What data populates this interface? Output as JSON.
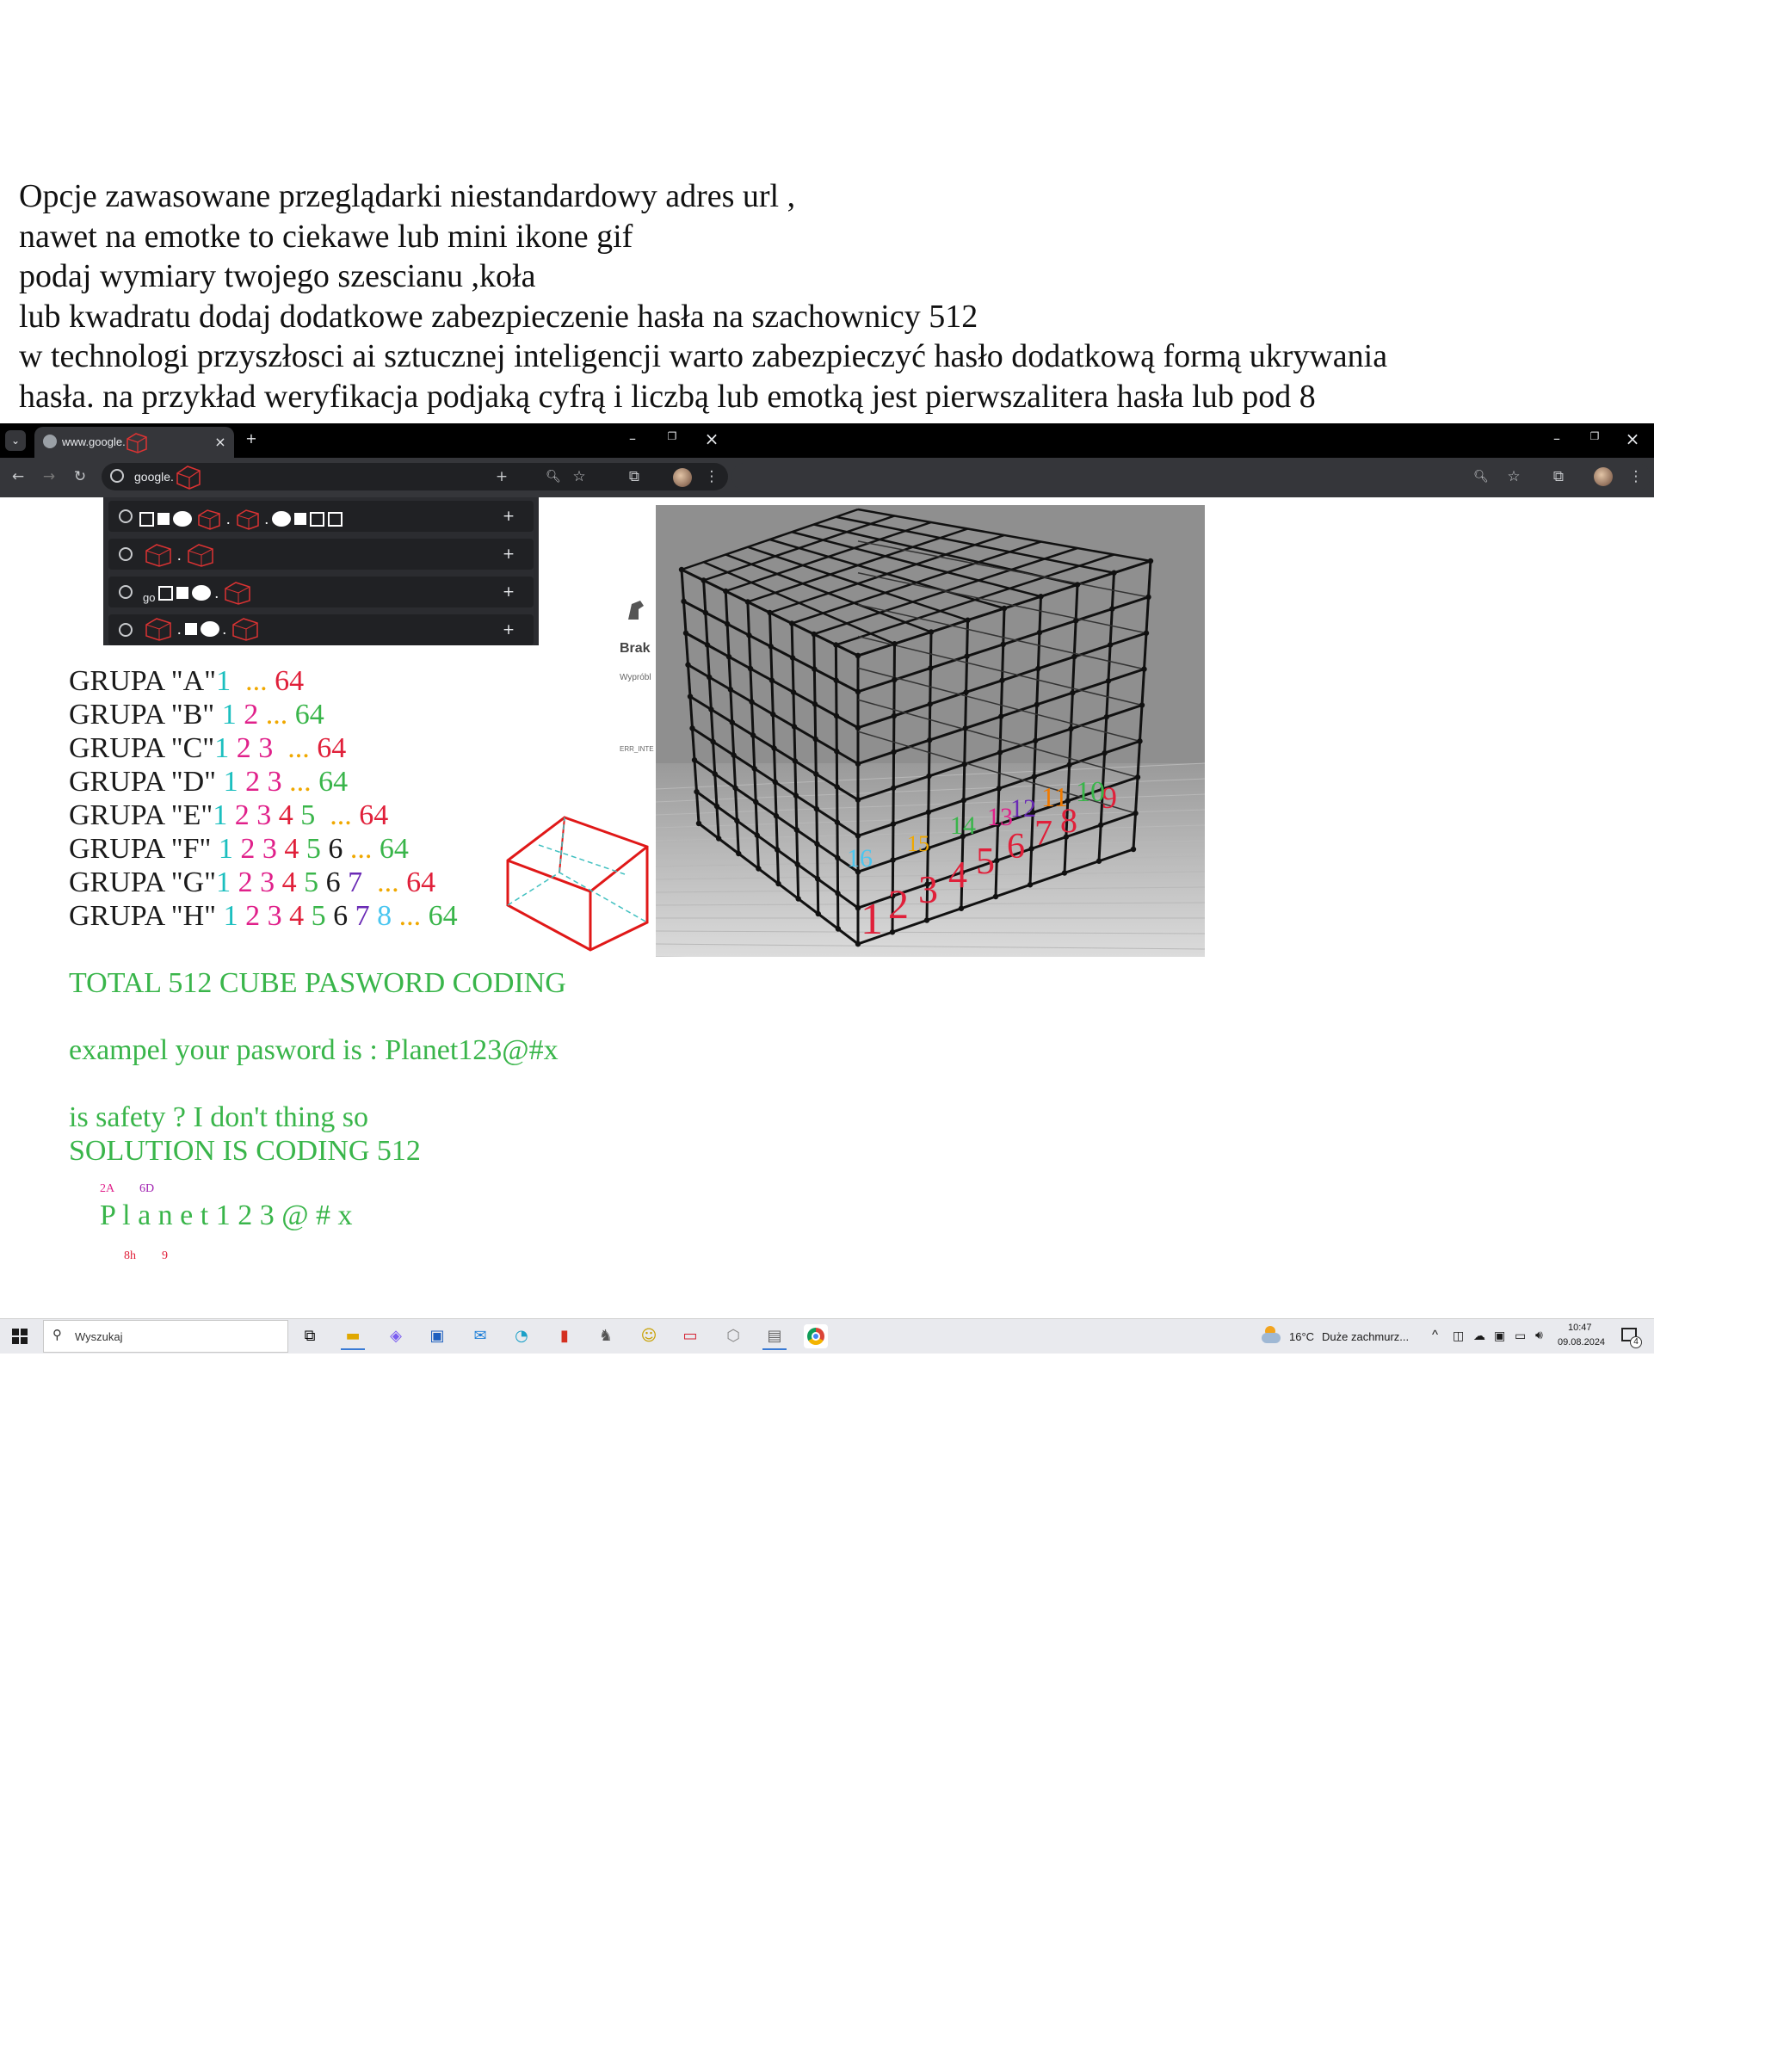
{
  "intro": [
    "Opcje zawasowane przeglądarki niestandardowy adres url ,",
    "nawet na emotke to ciekawe lub mini ikone gif",
    "podaj wymiary twojego szescianu ,koła",
    "lub kwadratu  dodaj dodatkowe zabezpieczenie hasła na szachownicy 512",
    "w technologi przyszłosci ai sztucznej inteligencji warto zabezpieczyć hasło dodatkową formą ukrywania",
    "hasła. na przykład weryfikacja podjaką cyfrą i liczbą lub emotką jest pierwszalitera hasła  lub pod 8"
  ],
  "browser": {
    "tab_title": "www.google.",
    "omnibox_text": "google.",
    "url_rows": [
      {
        "prefix": ""
      },
      {
        "prefix": ""
      },
      {
        "prefix": "go"
      },
      {
        "prefix": ""
      }
    ],
    "new_tab_symbol": "+",
    "close_symbol": "×",
    "minimize_symbol": "–",
    "restore_symbol": "❐"
  },
  "groups": [
    {
      "label": "GRUPA \"A\"",
      "tokens": [
        {
          "t": "1",
          "c": "teal"
        },
        {
          "t": "  ...",
          "c": "gold"
        },
        {
          "t": " 64",
          "c": "red"
        }
      ]
    },
    {
      "label": "GRUPA \"B\" ",
      "tokens": [
        {
          "t": "1",
          "c": "teal"
        },
        {
          "t": " 2",
          "c": "pink"
        },
        {
          "t": " ...",
          "c": "gold"
        },
        {
          "t": " 64",
          "c": "green"
        }
      ]
    },
    {
      "label": "GRUPA \"C\"",
      "tokens": [
        {
          "t": "1",
          "c": "teal"
        },
        {
          "t": " 2",
          "c": "pink"
        },
        {
          "t": " 3",
          "c": "pink"
        },
        {
          "t": "  ...",
          "c": "gold"
        },
        {
          "t": " 64",
          "c": "red"
        }
      ]
    },
    {
      "label": "GRUPA \"D\" ",
      "tokens": [
        {
          "t": "1",
          "c": "teal"
        },
        {
          "t": " 2",
          "c": "pink"
        },
        {
          "t": " 3",
          "c": "pink"
        },
        {
          "t": " ...",
          "c": "gold"
        },
        {
          "t": " 64",
          "c": "green"
        }
      ]
    },
    {
      "label": "GRUPA \"E\"",
      "tokens": [
        {
          "t": "1",
          "c": "teal"
        },
        {
          "t": " 2",
          "c": "pink"
        },
        {
          "t": " 3",
          "c": "pink"
        },
        {
          "t": " 4",
          "c": "red"
        },
        {
          "t": " 5",
          "c": "green"
        },
        {
          "t": "  ...",
          "c": "gold"
        },
        {
          "t": " 64",
          "c": "red"
        }
      ]
    },
    {
      "label": "GRUPA \"F\" ",
      "tokens": [
        {
          "t": "1",
          "c": "teal"
        },
        {
          "t": " 2",
          "c": "pink"
        },
        {
          "t": " 3",
          "c": "pink"
        },
        {
          "t": " 4",
          "c": "red"
        },
        {
          "t": " 5",
          "c": "green"
        },
        {
          "t": " 6",
          "c": "dark"
        },
        {
          "t": " ...",
          "c": "gold"
        },
        {
          "t": " 64",
          "c": "green"
        }
      ]
    },
    {
      "label": "GRUPA \"G\"",
      "tokens": [
        {
          "t": "1",
          "c": "teal"
        },
        {
          "t": " 2",
          "c": "pink"
        },
        {
          "t": " 3",
          "c": "pink"
        },
        {
          "t": " 4",
          "c": "red"
        },
        {
          "t": " 5",
          "c": "green"
        },
        {
          "t": " 6",
          "c": "dark"
        },
        {
          "t": " 7",
          "c": "purple"
        },
        {
          "t": "  ...",
          "c": "gold"
        },
        {
          "t": " 64",
          "c": "red"
        }
      ]
    },
    {
      "label": "GRUPA \"H\" ",
      "tokens": [
        {
          "t": "1",
          "c": "teal"
        },
        {
          "t": " 2",
          "c": "pink"
        },
        {
          "t": " 3",
          "c": "pink"
        },
        {
          "t": " 4",
          "c": "red"
        },
        {
          "t": " 5",
          "c": "green"
        },
        {
          "t": " 6",
          "c": "dark"
        },
        {
          "t": " 7",
          "c": "purple"
        },
        {
          "t": " 8",
          "c": "cyan"
        },
        {
          "t": " ...",
          "c": "gold"
        },
        {
          "t": " 64",
          "c": "green"
        }
      ]
    }
  ],
  "main": {
    "total": "TOTAL 512 CUBE  PASWORD CODING",
    "example": "exampel your pasword is : Planet123@#x",
    "question": "is safety ? I don't thing so",
    "solution": "SOLUTION IS CODING 512",
    "code_top_1": "2A",
    "code_top_2": "6D",
    "password_spaced": "P l a n e t 1 2 3 @ # x",
    "code_bottom_1": "8h",
    "code_bottom_2": "9"
  },
  "photo": {
    "underlying_text": "Brak",
    "underlying_small": "Wypróbl",
    "underlying_code": "ERR_INTE",
    "numbers": [
      {
        "t": "1",
        "c": "red"
      },
      {
        "t": "2",
        "c": "red"
      },
      {
        "t": "3",
        "c": "red"
      },
      {
        "t": "4",
        "c": "red"
      },
      {
        "t": "5",
        "c": "red"
      },
      {
        "t": "6",
        "c": "red"
      },
      {
        "t": "7",
        "c": "red"
      },
      {
        "t": "8",
        "c": "red"
      },
      {
        "t": "9",
        "c": "red"
      },
      {
        "t": "10",
        "c": "green"
      },
      {
        "t": "11",
        "c": "orange"
      },
      {
        "t": "12",
        "c": "purple"
      },
      {
        "t": "13",
        "c": "pink"
      },
      {
        "t": "14",
        "c": "green"
      },
      {
        "t": "15",
        "c": "gold"
      },
      {
        "t": "16",
        "c": "cyan"
      }
    ]
  },
  "taskbar": {
    "search_placeholder": "Wyszukaj",
    "weather_temp": "16°C",
    "weather_desc": "Duże zachmurz...",
    "time": "10:47",
    "date": "09.08.2024",
    "notification_count": "4"
  },
  "colors": {
    "dark": "#1a1a1a",
    "teal": "#1cbfbf",
    "pink": "#e0208a",
    "red": "#e0203a",
    "gold": "#f0a800",
    "green": "#39b54a",
    "purple": "#6a2ab5",
    "cyan": "#4ac6f0",
    "orange": "#f07a00"
  }
}
